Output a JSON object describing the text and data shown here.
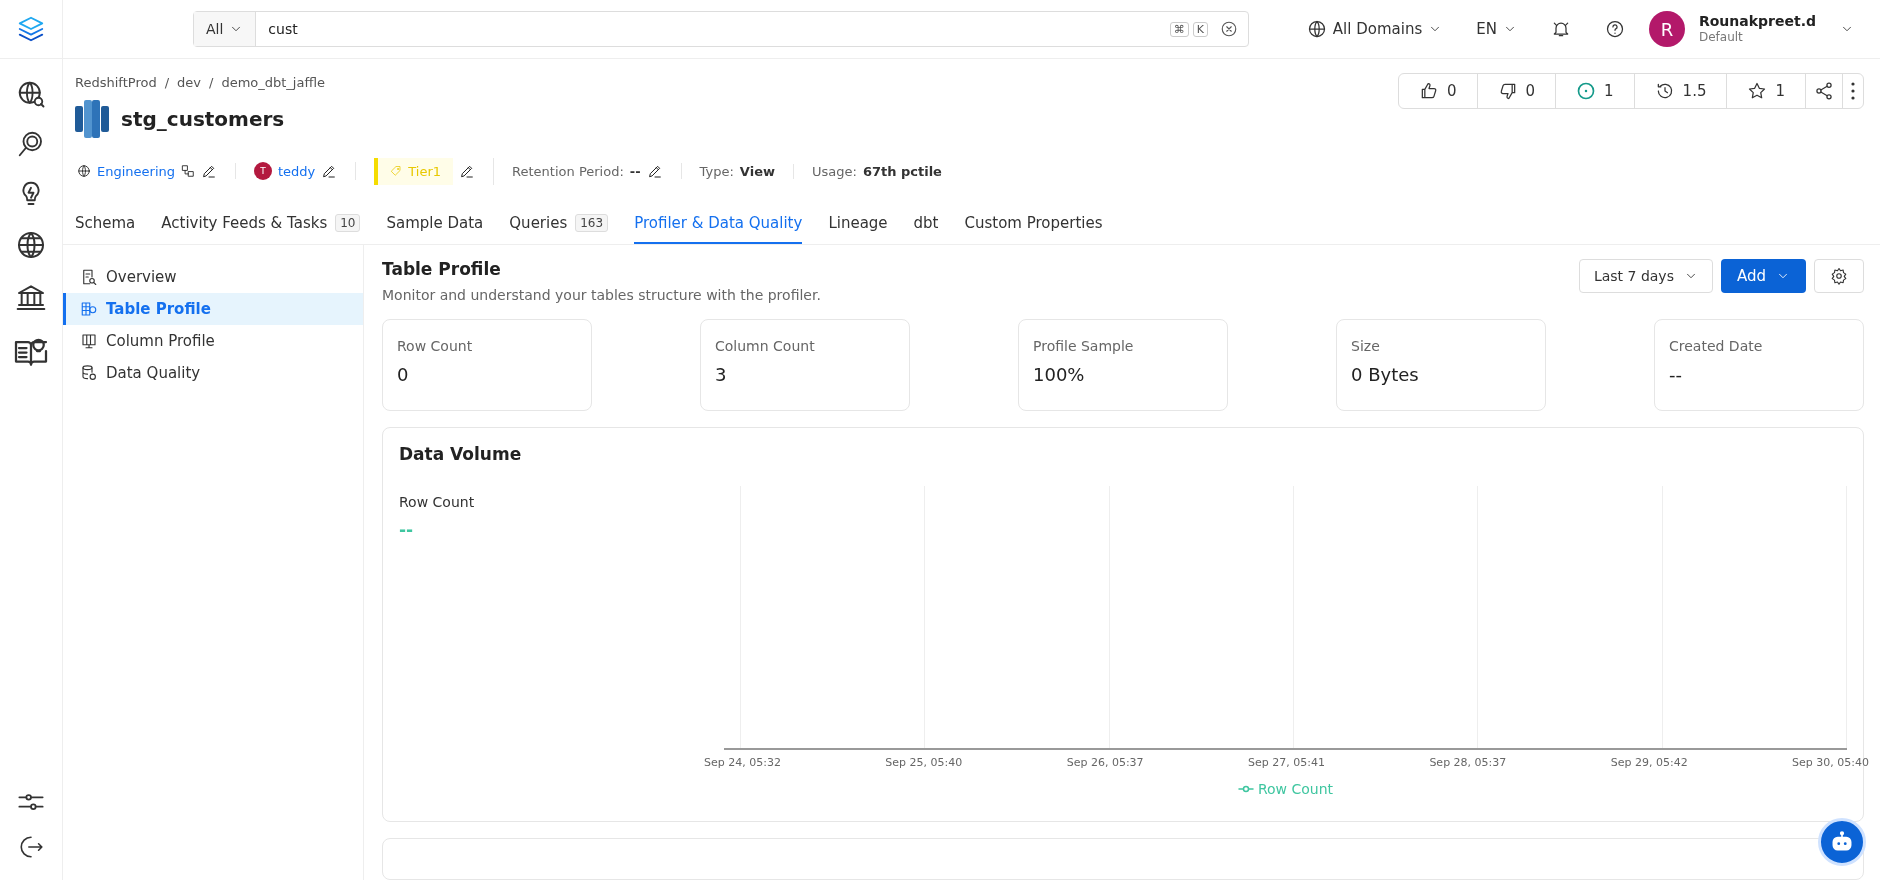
{
  "top_bar": {
    "search": {
      "scope": "All",
      "value": "cust",
      "keys": [
        "⌘",
        "K"
      ]
    },
    "domain": "All Domains",
    "language": "EN",
    "user": {
      "initial": "R",
      "name": "Rounakpreet.d",
      "role": "Default"
    }
  },
  "header": {
    "breadcrumbs": [
      "RedshiftProd",
      "dev",
      "demo_dbt_jaffle"
    ],
    "separator": "/",
    "title": "stg_customers",
    "domain": "Engineering",
    "owner": {
      "initial": "T",
      "name": "teddy"
    },
    "tier": "Tier1",
    "details": [
      {
        "label": "Retention Period:",
        "value": "--",
        "editable": true
      },
      {
        "label": "Type:",
        "value": "View",
        "editable": false
      },
      {
        "label": "Usage:",
        "value": "67th pctile",
        "editable": false
      }
    ],
    "actions": [
      {
        "kind": "like",
        "count": "0"
      },
      {
        "kind": "dislike",
        "count": "0"
      },
      {
        "kind": "follow",
        "count": "1"
      },
      {
        "kind": "version",
        "count": "1.5"
      },
      {
        "kind": "star",
        "count": "1"
      },
      {
        "kind": "share"
      },
      {
        "kind": "more"
      }
    ]
  },
  "tabs": [
    {
      "label": "Schema",
      "selected": false
    },
    {
      "label": "Activity Feeds & Tasks",
      "count": "10",
      "selected": false
    },
    {
      "label": "Sample Data",
      "selected": false
    },
    {
      "label": "Queries",
      "count": "163",
      "selected": false
    },
    {
      "label": "Profiler & Data Quality",
      "selected": true
    },
    {
      "label": "Lineage",
      "selected": false
    },
    {
      "label": "dbt",
      "selected": false
    },
    {
      "label": "Custom Properties",
      "selected": false
    }
  ],
  "side_menu": [
    {
      "kind": "overview",
      "label": "Overview",
      "selected": false
    },
    {
      "kind": "table",
      "label": "Table Profile",
      "selected": true
    },
    {
      "kind": "column",
      "label": "Column Profile",
      "selected": false
    },
    {
      "kind": "quality",
      "label": "Data Quality",
      "selected": false
    }
  ],
  "profile": {
    "title": "Table Profile",
    "description": "Monitor and understand your tables structure with the profiler.",
    "range": "Last 7 days",
    "add": "Add",
    "stats": [
      {
        "label": "Row Count",
        "value": "0"
      },
      {
        "label": "Column Count",
        "value": "3"
      },
      {
        "label": "Profile Sample",
        "value": "100%"
      },
      {
        "label": "Size",
        "value": "0 Bytes"
      },
      {
        "label": "Created Date",
        "value": "--"
      }
    ]
  },
  "data_volume": {
    "title": "Data Volume",
    "metric": "Row Count",
    "value": "--",
    "x_labels": [
      "Sep 24, 05:32",
      "Sep 25, 05:40",
      "Sep 26, 05:37",
      "Sep 27, 05:41",
      "Sep 28, 05:37",
      "Sep 29, 05:42",
      "Sep 30, 05:40"
    ],
    "legend": "Row Count"
  }
}
